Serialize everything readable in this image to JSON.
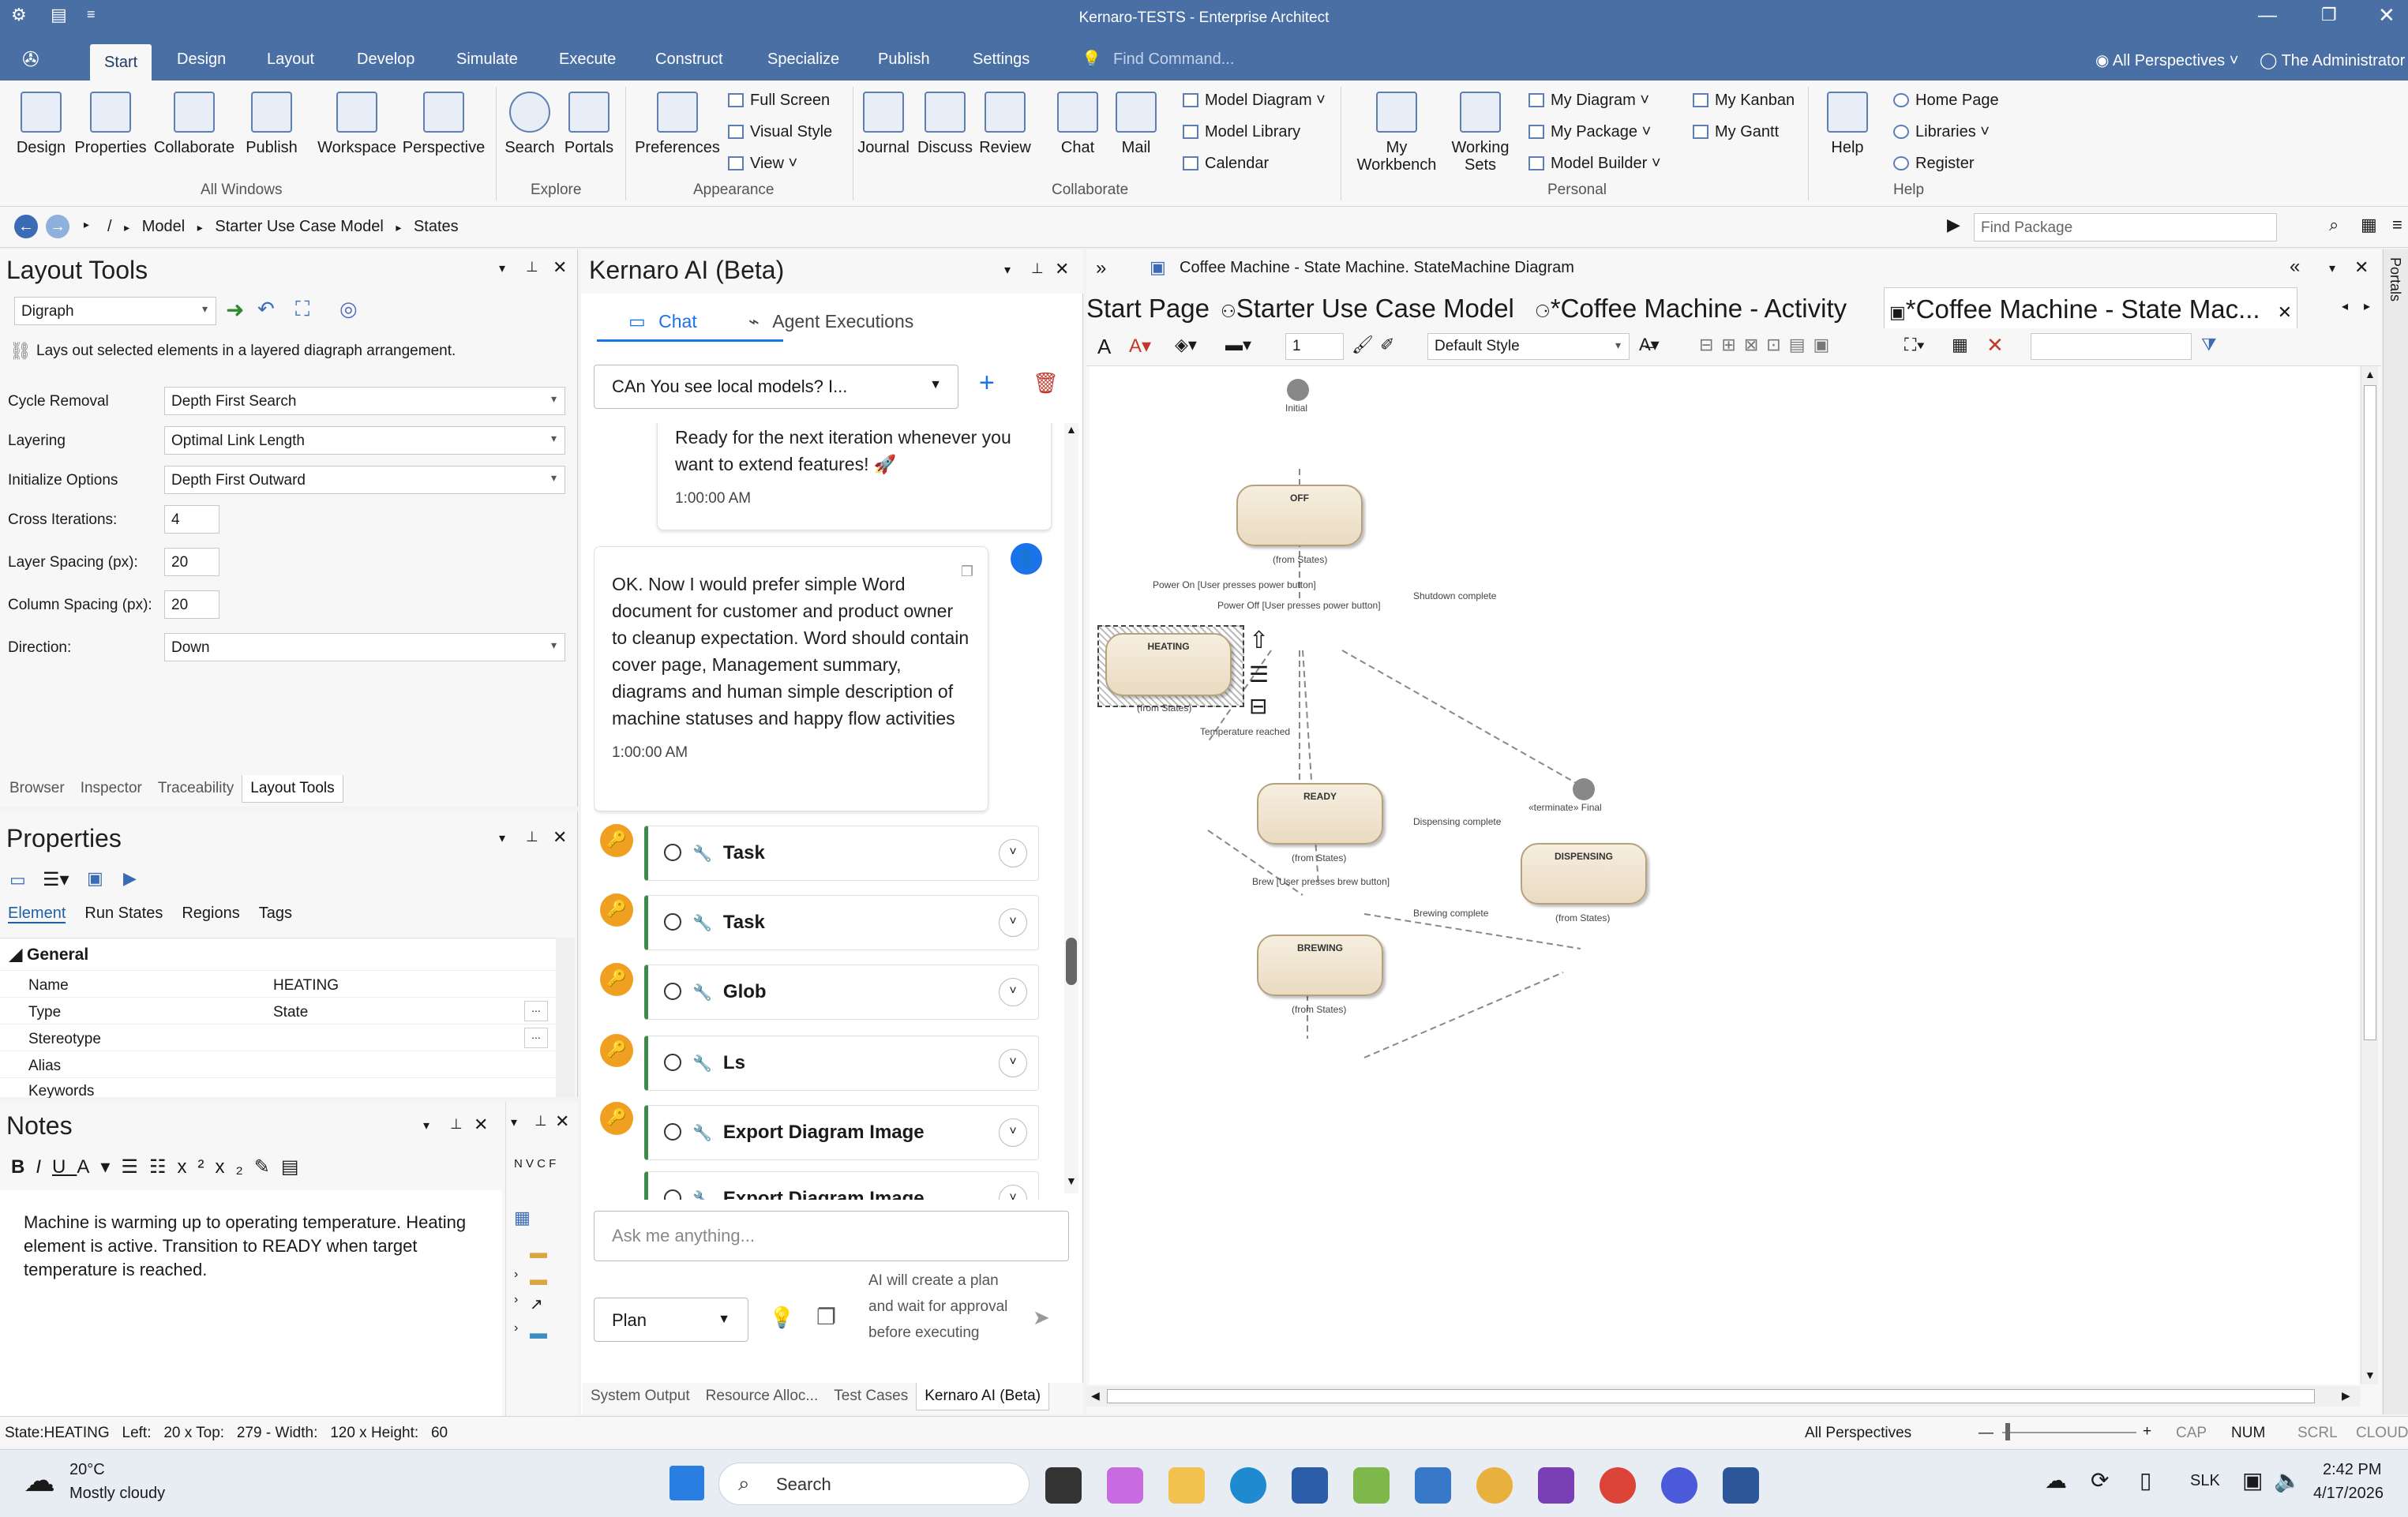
{
  "window": {
    "title": "Kernaro-TESTS - Enterprise Architect"
  },
  "menu": {
    "tabs": [
      "Start",
      "Design",
      "Layout",
      "Develop",
      "Simulate",
      "Execute",
      "Construct",
      "Specialize",
      "Publish",
      "Settings"
    ],
    "find_command": "Find Command...",
    "perspectives": "All Perspectives",
    "user": "The Administrator"
  },
  "ribbon": {
    "all_windows": {
      "group": "All Windows",
      "buttons": [
        "Design",
        "Properties",
        "Collaborate",
        "Publish",
        "Workspace",
        "Perspective"
      ]
    },
    "explore": {
      "group": "Explore",
      "buttons": [
        "Search",
        "Portals"
      ]
    },
    "appearance": {
      "group": "Appearance",
      "preferences": "Preferences",
      "items": [
        "Full Screen",
        "Visual Style",
        "View"
      ]
    },
    "collaborate": {
      "group": "Collaborate",
      "buttons": [
        "Journal",
        "Discuss",
        "Review",
        "Chat",
        "Mail"
      ],
      "items": [
        "Model Diagram",
        "Model Library",
        "Calendar"
      ]
    },
    "personal": {
      "group": "Personal",
      "buttons": [
        "My Workbench",
        "Working Sets"
      ],
      "items": [
        "My Diagram",
        "My Package",
        "Model Builder",
        "My Kanban",
        "My Gantt"
      ]
    },
    "help": {
      "group": "Help",
      "button": "Help",
      "items": [
        "Home Page",
        "Libraries",
        "Register"
      ]
    }
  },
  "nav": {
    "breadcrumb": [
      "/",
      "Model",
      "Starter Use Case Model",
      "States"
    ],
    "find_package": "Find Package"
  },
  "layout_tools": {
    "title": "Layout Tools",
    "layout": "Digraph",
    "description": "Lays out selected elements in a layered diagraph arrangement.",
    "fields": [
      {
        "label": "Cycle Removal",
        "value": "Depth First Search"
      },
      {
        "label": "Layering",
        "value": "Optimal Link Length"
      },
      {
        "label": "Initialize Options",
        "value": "Depth First Outward"
      },
      {
        "label": "Cross Iterations:",
        "value": "4"
      },
      {
        "label": "Layer Spacing (px):",
        "value": "20"
      },
      {
        "label": "Column Spacing (px):",
        "value": "20"
      },
      {
        "label": "Direction:",
        "value": "Down"
      }
    ],
    "tabs": [
      "Browser",
      "Inspector",
      "Traceability",
      "Layout Tools"
    ]
  },
  "properties": {
    "title": "Properties",
    "tabs": [
      "Element",
      "Run States",
      "Regions",
      "Tags"
    ],
    "section": "General",
    "rows": [
      {
        "key": "Name",
        "value": "HEATING"
      },
      {
        "key": "Type",
        "value": "State"
      },
      {
        "key": "Stereotype",
        "value": ""
      },
      {
        "key": "Alias",
        "value": ""
      },
      {
        "key": "Keywords",
        "value": ""
      }
    ]
  },
  "notes": {
    "title": "Notes",
    "text": "Machine is warming up to operating temperature. Heating element is active. Transition to READY when target temperature is reached.",
    "side_letters": "N V C F"
  },
  "ai": {
    "title": "Kernaro AI (Beta)",
    "tabs": [
      "Chat",
      "Agent Executions"
    ],
    "conversation": "CAn You see local models? I...",
    "msg1": {
      "text": "Ready for the next iteration whenever you want to extend features! 🚀",
      "time": "1:00:00 AM"
    },
    "msg2": {
      "text": "OK. Now I would prefer simple Word document for customer and product owner to cleanup expectation. Word should contain cover page, Management summary, diagrams and human simple description of machine statuses and happy flow activities",
      "time": "1:00:00 AM"
    },
    "tasks": [
      "Task",
      "Task",
      "Glob",
      "Ls",
      "Export Diagram Image",
      "Export Diagram Image"
    ],
    "input_placeholder": "Ask me anything...",
    "mode": "Plan",
    "mode_hint": "AI will create a plan and wait for approval before executing",
    "bottom_tabs": [
      "System Output",
      "Resource Alloc...",
      "Test Cases",
      "Kernaro AI (Beta)"
    ]
  },
  "diagram": {
    "header": "Coffee Machine - State Machine.  StateMachine Diagram",
    "tabs": [
      "Start Page",
      "Starter Use Case Model",
      "*Coffee Machine - Activity",
      "*Coffee Machine - State Mac..."
    ],
    "zoom": "1",
    "style": "Default Style",
    "states": [
      {
        "name": "OFF",
        "from": "(from States)"
      },
      {
        "name": "HEATING",
        "from": "(from States)"
      },
      {
        "name": "READY",
        "from": "(from States)"
      },
      {
        "name": "DISPENSING",
        "from": "(from States)"
      },
      {
        "name": "BREWING",
        "from": "(from States)"
      }
    ],
    "initial": "Initial",
    "final": "«terminate» Final",
    "transitions": [
      "Power On [User presses power button]",
      "Power Off [User presses power button]",
      "Shutdown complete",
      "Temperature reached",
      "Dispensing complete",
      "Brew [User presses brew button]",
      "Brewing complete"
    ],
    "portals": "Portals"
  },
  "statusbar": {
    "left": "State:HEATING   Left:   20 x Top:   279 - Width:   120 x Height:   60",
    "perspectives": "All Perspectives",
    "indicators": [
      "CAP",
      "NUM",
      "SCRL",
      "CLOUD"
    ]
  },
  "taskbar": {
    "weather_temp": "20°C",
    "weather_desc": "Mostly cloudy",
    "search": "Search",
    "lang": "SLK",
    "time": "2:42 PM",
    "date": "4/17/2026"
  },
  "colors": {
    "accent": "#4a6fa5",
    "task_ok": "#3d8a4a",
    "tool_badge": "#f0a020",
    "chat_blue": "#1a73e8"
  }
}
